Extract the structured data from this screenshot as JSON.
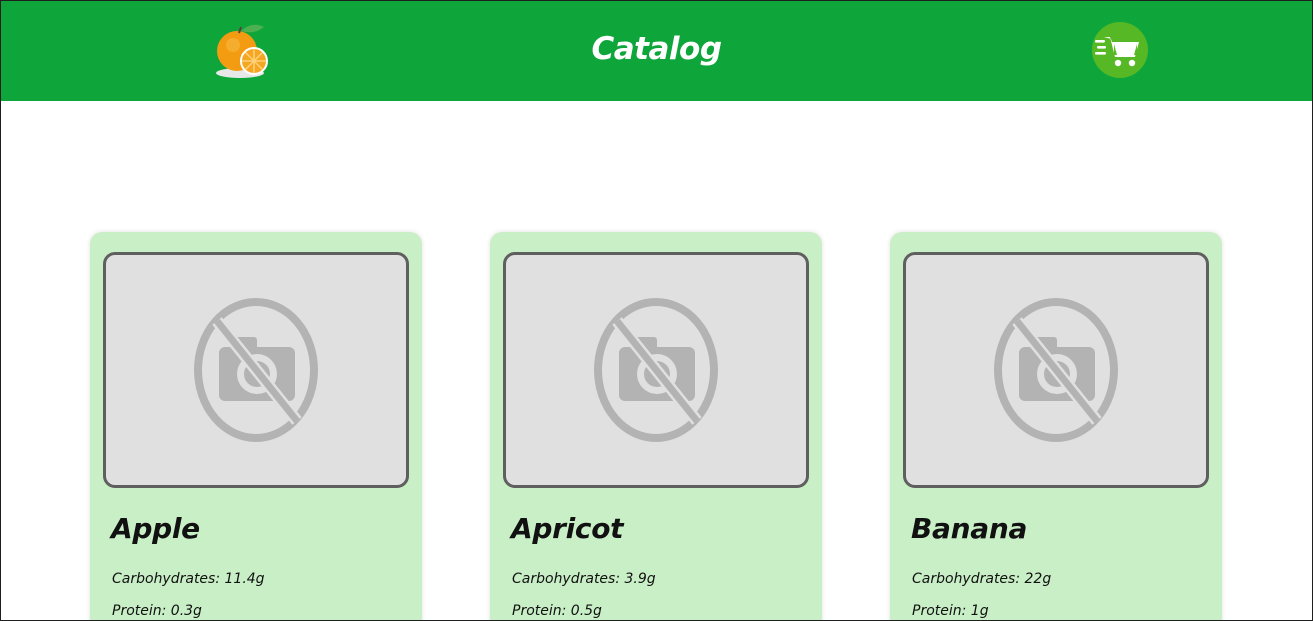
{
  "header": {
    "title": "Catalog",
    "logo_icon": "orange-fruit-icon",
    "cart_icon": "fast-cart-icon",
    "background_color": "#0ea63b",
    "cart_button_color": "#56b824"
  },
  "catalog": {
    "card_color": "#c9efc7",
    "placeholder_icon": "no-camera-icon",
    "items": [
      {
        "name": "Apple",
        "carbohydrates": "Carbohydrates: 11.4g",
        "protein": "Protein: 0.3g"
      },
      {
        "name": "Apricot",
        "carbohydrates": "Carbohydrates: 3.9g",
        "protein": "Protein: 0.5g"
      },
      {
        "name": "Banana",
        "carbohydrates": "Carbohydrates: 22g",
        "protein": "Protein: 1g"
      }
    ]
  }
}
